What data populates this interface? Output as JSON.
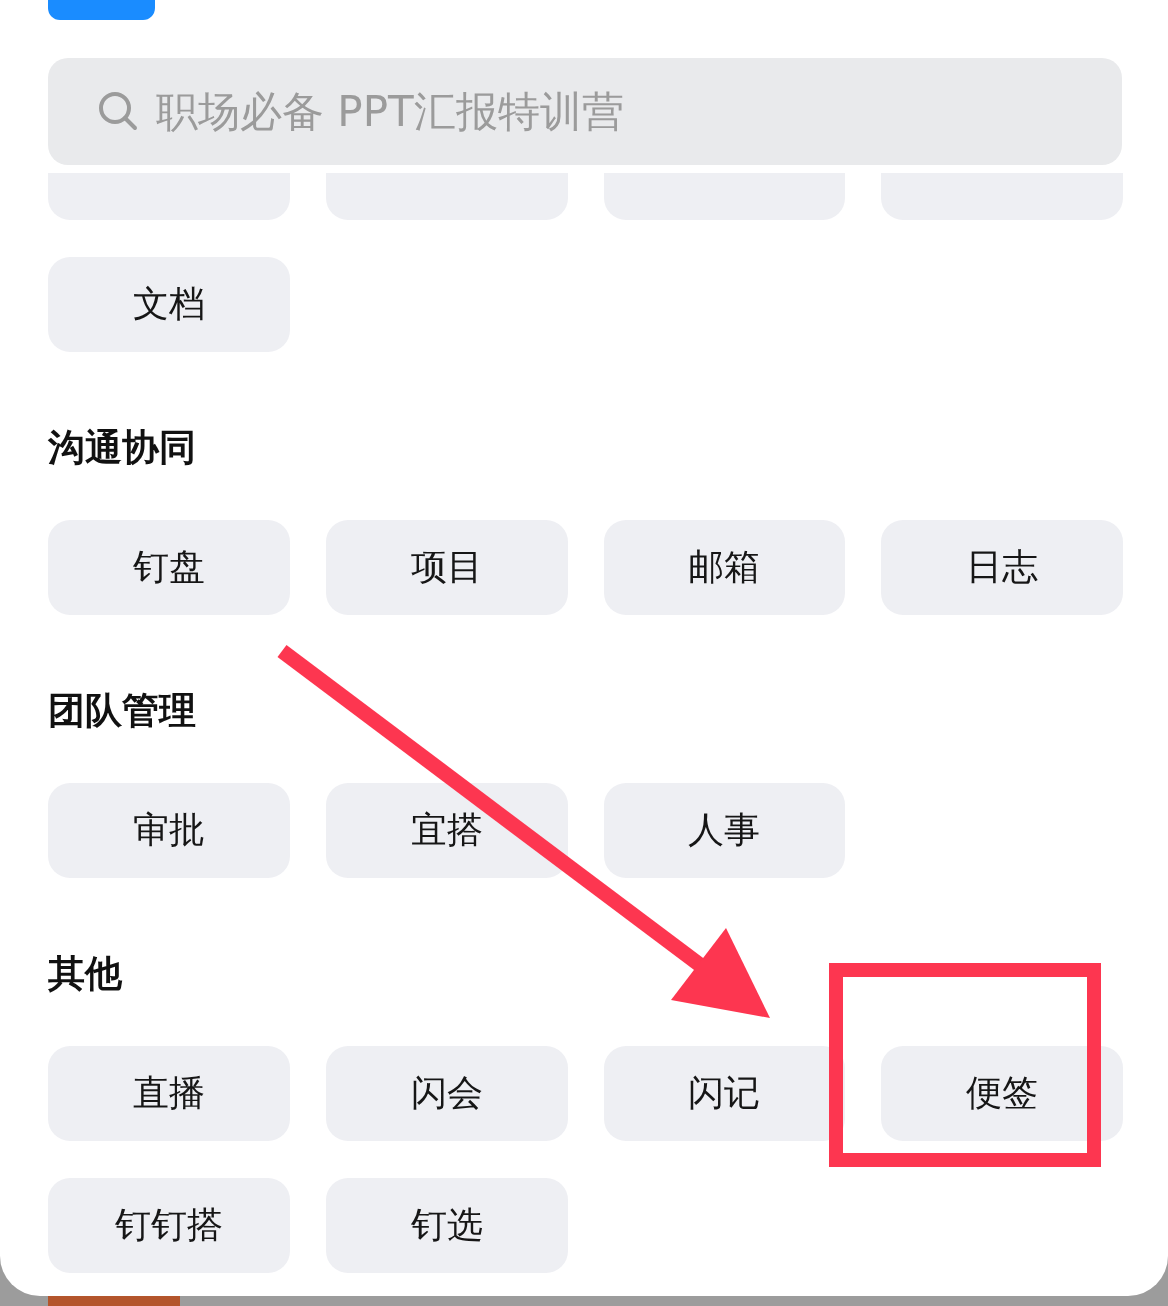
{
  "search": {
    "placeholder": "职场必备 PPT汇报特训营"
  },
  "sections": [
    {
      "tiles": [
        {
          "kind": "cut"
        },
        {
          "kind": "cut"
        },
        {
          "kind": "cut"
        },
        {
          "kind": "cut"
        },
        {
          "kind": "full",
          "label": "文档"
        }
      ]
    },
    {
      "heading": "沟通协同",
      "tiles": [
        {
          "kind": "full",
          "label": "钉盘"
        },
        {
          "kind": "full",
          "label": "项目"
        },
        {
          "kind": "full",
          "label": "邮箱"
        },
        {
          "kind": "full",
          "label": "日志"
        }
      ]
    },
    {
      "heading": "团队管理",
      "tiles": [
        {
          "kind": "full",
          "label": "审批"
        },
        {
          "kind": "full",
          "label": "宜搭"
        },
        {
          "kind": "full",
          "label": "人事"
        }
      ]
    },
    {
      "heading": "其他",
      "tiles": [
        {
          "kind": "full",
          "label": "直播"
        },
        {
          "kind": "full",
          "label": "闪会"
        },
        {
          "kind": "full",
          "label": "闪记"
        },
        {
          "kind": "full",
          "label": "便签"
        },
        {
          "kind": "full",
          "label": "钉钉搭"
        },
        {
          "kind": "full",
          "label": "钉选"
        }
      ]
    }
  ]
}
